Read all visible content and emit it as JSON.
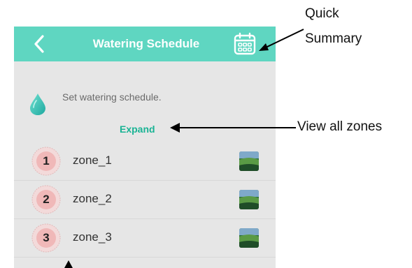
{
  "appbar": {
    "title": "Watering Schedule",
    "accent_color": "#5fd6c1",
    "back_icon": "chevron-left-icon",
    "calendar_icon": "calendar-icon"
  },
  "hint": {
    "icon": "water-drop-icon",
    "text": "Set watering schedule."
  },
  "expand_label": "Expand",
  "zones": [
    {
      "number": "1",
      "name": "zone_1"
    },
    {
      "number": "2",
      "name": "zone_2"
    },
    {
      "number": "3",
      "name": "zone_3"
    }
  ],
  "annotations": {
    "quick_summary_line1": "Quick",
    "quick_summary_line2": "Summary",
    "view_all_zones": "View all zones"
  }
}
